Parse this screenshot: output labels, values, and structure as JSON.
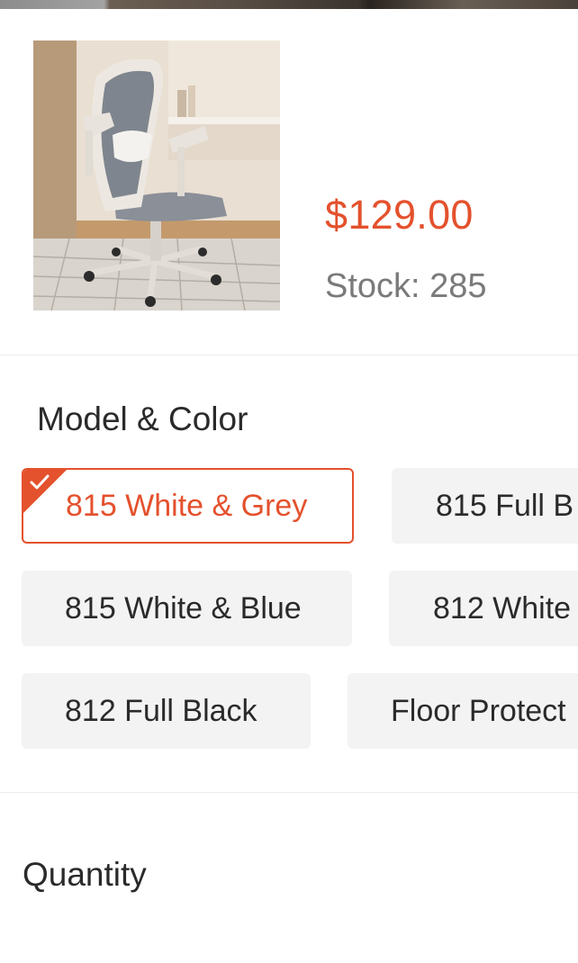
{
  "product": {
    "image_alt": "Grey mesh office chair with white frame",
    "price": "$129.00",
    "stock": "Stock: 285"
  },
  "variants": {
    "title": "Model & Color",
    "options": [
      {
        "label": "815 White & Grey",
        "selected": true
      },
      {
        "label": "815 Full B",
        "selected": false
      },
      {
        "label": "815 White & Blue",
        "selected": false
      },
      {
        "label": "812 White",
        "selected": false
      },
      {
        "label": "812 Full Black",
        "selected": false
      },
      {
        "label": "Floor Protect",
        "selected": false
      }
    ]
  },
  "quantity": {
    "title": "Quantity"
  },
  "colors": {
    "accent": "#e4512d",
    "chip_bg": "#f3f3f3",
    "muted_text": "#7a7a7a"
  },
  "icons": {
    "selected_check": "checkmark-icon"
  }
}
